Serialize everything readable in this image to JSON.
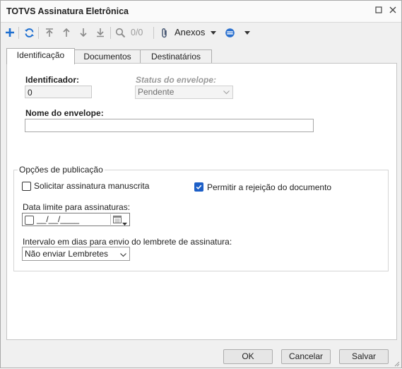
{
  "window": {
    "title": "TOTVS Assinatura Eletrônica",
    "maximize_icon": "maximize-icon",
    "close_icon": "close-icon"
  },
  "toolbar": {
    "page_counter": "0/0",
    "attachments_label": "Anexos",
    "icons": [
      "add-icon",
      "refresh-icon",
      "first-record-icon",
      "previous-record-icon",
      "next-record-icon",
      "last-record-icon",
      "search-icon",
      "paperclip-icon",
      "options-icon"
    ]
  },
  "tabs": [
    {
      "label": "Identificação",
      "active": true
    },
    {
      "label": "Documentos",
      "active": false
    },
    {
      "label": "Destinatários",
      "active": false
    }
  ],
  "form": {
    "identifier_label": "Identificador:",
    "identifier_value": "0",
    "status_label": "Status do envelope:",
    "status_value": "Pendente",
    "envelope_name_label": "Nome do envelope:",
    "envelope_name_value": ""
  },
  "publication": {
    "group_title": "Opções de publicação",
    "handwritten_label": "Solicitar assinatura manuscrita",
    "handwritten_checked": false,
    "allow_reject_label": "Permitir a rejeição do documento",
    "allow_reject_checked": true,
    "deadline_label": "Data limite para assinaturas:",
    "deadline_value": "__/__/____",
    "reminder_label": "Intervalo em dias para envio do lembrete de assinatura:",
    "reminder_value": "Não enviar Lembretes"
  },
  "buttons": {
    "ok": "OK",
    "cancel": "Cancelar",
    "save": "Salvar"
  },
  "colors": {
    "accent": "#1d5fc7",
    "icon_gray": "#8a8a8a",
    "add_icon": "#1e6fd0"
  }
}
